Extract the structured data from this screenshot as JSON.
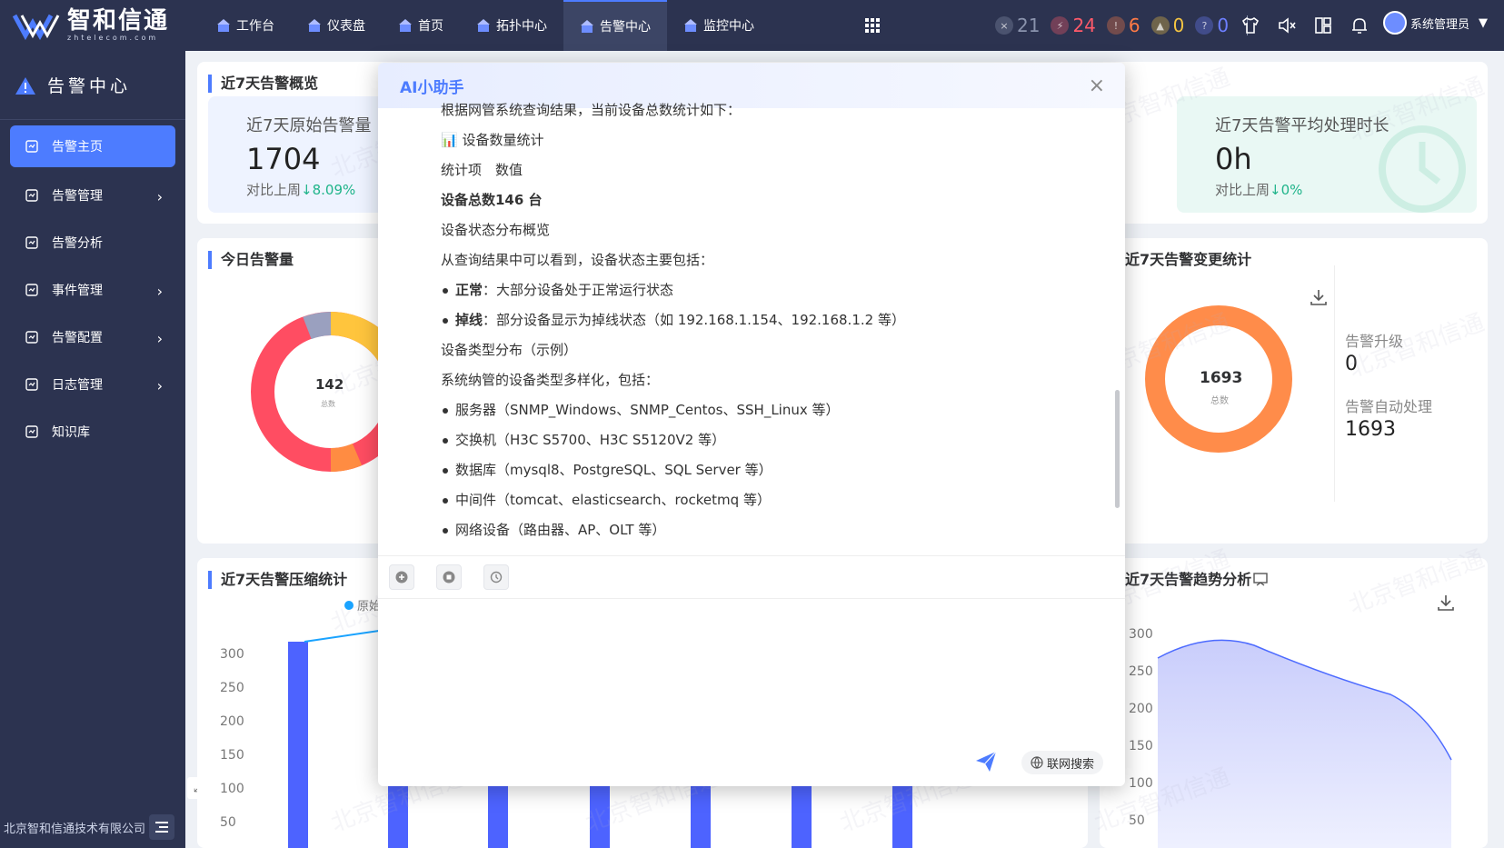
{
  "brand": {
    "name": "智和信通",
    "sub": "zhtelecom.com"
  },
  "nav": [
    {
      "label": "工作台",
      "icon": "home-icon"
    },
    {
      "label": "仪表盘",
      "icon": "dashboard-icon"
    },
    {
      "label": "首页",
      "icon": "home-icon"
    },
    {
      "label": "拓扑中心",
      "icon": "topology-icon"
    },
    {
      "label": "告警中心",
      "icon": "alarm-icon",
      "active": true
    },
    {
      "label": "监控中心",
      "icon": "monitor-icon"
    }
  ],
  "status": [
    {
      "value": "21",
      "color": "#8a93ad",
      "icon": "×"
    },
    {
      "value": "24",
      "color": "#ff5a6a",
      "icon": "⚡"
    },
    {
      "value": "6",
      "color": "#ff7a45",
      "icon": "!"
    },
    {
      "value": "0",
      "color": "#f5c542",
      "icon": "▲"
    },
    {
      "value": "0",
      "color": "#6d7fff",
      "icon": "?"
    }
  ],
  "user": {
    "name": "系统管理员"
  },
  "sidebar": {
    "title": "告警中心",
    "items": [
      {
        "label": "告警主页",
        "active": true,
        "chev": false
      },
      {
        "label": "告警管理",
        "chev": true
      },
      {
        "label": "告警分析",
        "chev": false
      },
      {
        "label": "事件管理",
        "chev": true
      },
      {
        "label": "告警配置",
        "chev": true
      },
      {
        "label": "日志管理",
        "chev": true
      },
      {
        "label": "知识库",
        "chev": false
      }
    ],
    "footer": "北京智和信通技术有限公司"
  },
  "overview": {
    "title": "近7天告警概览",
    "raw": {
      "label": "近7天原始告警量",
      "value": "1704",
      "compare": "对比上周",
      "delta": "↓8.09%"
    },
    "avg": {
      "label": "近7天告警平均处理时长",
      "value": "0h",
      "compare": "对比上周",
      "delta": "↓0%"
    }
  },
  "today": {
    "title": "今日告警量",
    "total": "142",
    "total_label": "总数"
  },
  "change": {
    "title": "近7天告警变更统计",
    "total": "1693",
    "total_label": "总数",
    "upgrade_label": "告警升级",
    "upgrade_value": "0",
    "auto_label": "告警自动处理",
    "auto_value": "1693"
  },
  "compress": {
    "title": "近7天告警压缩统计",
    "legend": "原始",
    "yticks": [
      "300",
      "250",
      "200",
      "150",
      "100",
      "50"
    ]
  },
  "trend": {
    "title": "近7天告警趋势分析",
    "yticks": [
      "300",
      "250",
      "200",
      "150",
      "100",
      "50"
    ]
  },
  "modal": {
    "title": "AI小助手",
    "lines": [
      {
        "text": "根据网管系统查询结果，当前设备总数统计如下：",
        "type": "text"
      },
      {
        "text": "📊 设备数量统计",
        "type": "text"
      },
      {
        "text": "统计项　数值",
        "type": "text"
      },
      {
        "text": "设备总数146 台",
        "type": "bold"
      },
      {
        "text": "设备状态分布概览",
        "type": "text"
      },
      {
        "text": "从查询结果中可以看到，设备状态主要包括：",
        "type": "text"
      },
      {
        "text": "正常：大部分设备处于正常运行状态",
        "type": "bullet",
        "strong": "正常"
      },
      {
        "text": "掉线：部分设备显示为掉线状态（如 192.168.1.154、192.168.1.2 等）",
        "type": "bullet",
        "strong": "掉线"
      },
      {
        "text": "设备类型分布（示例）",
        "type": "text"
      },
      {
        "text": "系统纳管的设备类型多样化，包括：",
        "type": "text"
      },
      {
        "text": "服务器（SNMP_Windows、SNMP_Centos、SSH_Linux 等）",
        "type": "bullet"
      },
      {
        "text": "交换机（H3C S5700、H3C S5120V2 等）",
        "type": "bullet"
      },
      {
        "text": "数据库（mysql8、PostgreSQL、SQL Server 等）",
        "type": "bullet"
      },
      {
        "text": "中间件（tomcat、elasticsearch、rocketmq 等）",
        "type": "bullet"
      },
      {
        "text": "网络设备（路由器、AP、OLT 等）",
        "type": "bullet"
      }
    ],
    "web_search": "联网搜索"
  },
  "watermark": "北京智和信通"
}
